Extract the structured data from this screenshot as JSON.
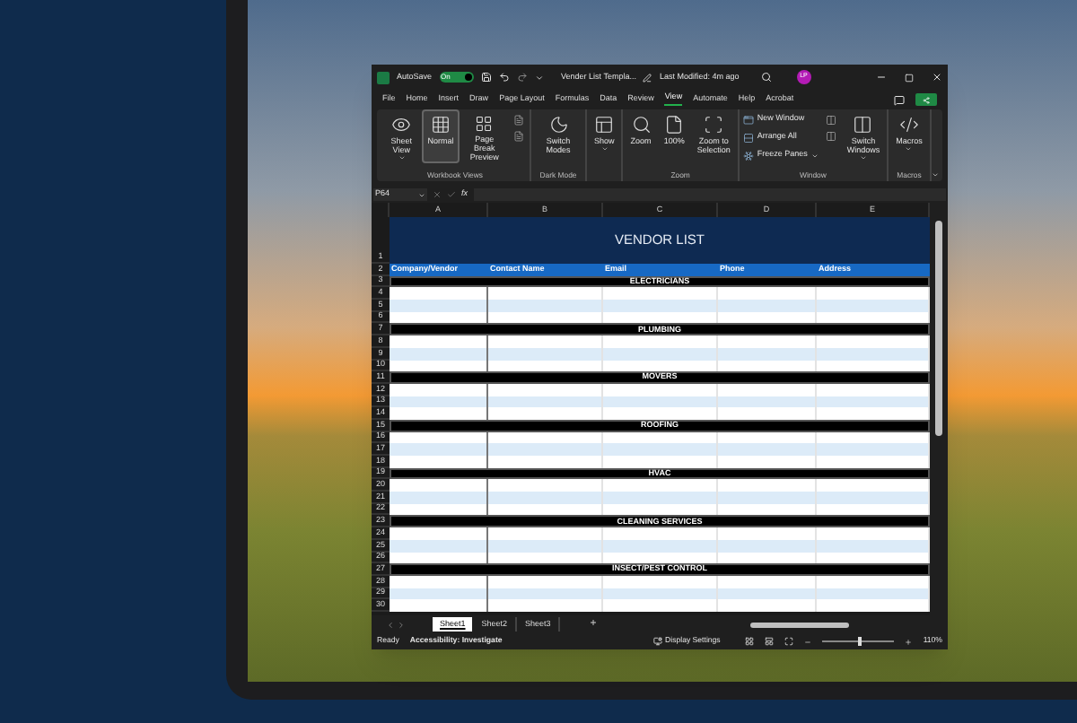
{
  "window": {
    "autosave": {
      "label": "AutoSave",
      "on": true,
      "state_text": "On"
    },
    "title": "Vender List Templa...",
    "modified": "Last Modified: 4m ago",
    "avatar": "LP"
  },
  "menu": [
    {
      "label": "File",
      "selected": false
    },
    {
      "label": "Home",
      "selected": false
    },
    {
      "label": "Insert",
      "selected": false
    },
    {
      "label": "Draw",
      "selected": false
    },
    {
      "label": "Page Layout",
      "selected": false
    },
    {
      "label": "Formulas",
      "selected": false
    },
    {
      "label": "Data",
      "selected": false
    },
    {
      "label": "Review",
      "selected": false
    },
    {
      "label": "View",
      "selected": true
    },
    {
      "label": "Automate",
      "selected": false
    },
    {
      "label": "Help",
      "selected": false
    },
    {
      "label": "Acrobat",
      "selected": false
    }
  ],
  "ribbon": [
    {
      "label": "Workbook Views",
      "buttons": [
        {
          "kind": "large",
          "label": "Sheet View",
          "selected": false,
          "dropdown": true
        },
        {
          "kind": "large",
          "label": "Normal",
          "selected": true,
          "dropdown": false
        },
        {
          "kind": "large",
          "label": "Page Break Preview",
          "selected": false,
          "dropdown": false
        }
      ]
    },
    {
      "label": "Dark Mode",
      "buttons": [
        {
          "kind": "large",
          "label": "Switch Modes",
          "selected": false,
          "dropdown": false
        }
      ]
    },
    {
      "buttons": [
        {
          "kind": "large",
          "label": "Show",
          "selected": false,
          "dropdown": true
        }
      ]
    },
    {
      "label": "Zoom",
      "buttons": [
        {
          "kind": "large",
          "label": "Zoom",
          "selected": false,
          "dropdown": false
        },
        {
          "kind": "large",
          "label": "100%",
          "selected": false,
          "dropdown": false
        },
        {
          "kind": "large",
          "label": "Zoom to Selection",
          "selected": false,
          "dropdown": false
        }
      ]
    },
    {
      "label": "Window",
      "buttons": [
        {
          "kind": "small",
          "label": "New Window",
          "selected": false,
          "dropdown": false
        },
        {
          "kind": "small",
          "label": "Arrange All",
          "selected": false,
          "dropdown": false
        },
        {
          "kind": "small",
          "label": "Freeze Panes",
          "selected": false,
          "dropdown": true
        },
        {
          "kind": "large",
          "label": "Switch Windows",
          "selected": false,
          "dropdown": true
        }
      ]
    },
    {
      "label": "Macros",
      "buttons": [
        {
          "kind": "large",
          "label": "Macros",
          "selected": false,
          "dropdown": true
        }
      ]
    }
  ],
  "formula_bar": {
    "name_box": "P64",
    "fx": "fx"
  },
  "columns": [
    "A",
    "B",
    "C",
    "D",
    "E"
  ],
  "rows": [
    {
      "number": "1",
      "kind": "title",
      "text": "VENDOR LIST"
    },
    {
      "number": "2",
      "kind": "header",
      "cells": [
        "Company/Vendor",
        "Contact Name",
        "Email",
        "Phone",
        "Address"
      ]
    },
    {
      "number": "3",
      "kind": "section",
      "text": "ELECTRICIANS"
    },
    {
      "number": "4",
      "kind": "blank",
      "shaded": false
    },
    {
      "number": "5",
      "kind": "blank",
      "shaded": true
    },
    {
      "number": "6",
      "kind": "blank",
      "shaded": false
    },
    {
      "number": "7",
      "kind": "section",
      "text": "PLUMBING"
    },
    {
      "number": "8",
      "kind": "blank",
      "shaded": false
    },
    {
      "number": "9",
      "kind": "blank",
      "shaded": true
    },
    {
      "number": "10",
      "kind": "blank",
      "shaded": false
    },
    {
      "number": "11",
      "kind": "section",
      "text": "MOVERS"
    },
    {
      "number": "12",
      "kind": "blank",
      "shaded": false
    },
    {
      "number": "13",
      "kind": "blank",
      "shaded": true
    },
    {
      "number": "14",
      "kind": "blank",
      "shaded": false
    },
    {
      "number": "15",
      "kind": "section",
      "text": "ROOFING"
    },
    {
      "number": "16",
      "kind": "blank",
      "shaded": false
    },
    {
      "number": "17",
      "kind": "blank",
      "shaded": true
    },
    {
      "number": "18",
      "kind": "blank",
      "shaded": false
    },
    {
      "number": "19",
      "kind": "section",
      "text": "HVAC"
    },
    {
      "number": "20",
      "kind": "blank",
      "shaded": false
    },
    {
      "number": "21",
      "kind": "blank",
      "shaded": true
    },
    {
      "number": "22",
      "kind": "blank",
      "shaded": false
    },
    {
      "number": "23",
      "kind": "section",
      "text": "CLEANING SERVICES"
    },
    {
      "number": "24",
      "kind": "blank",
      "shaded": false
    },
    {
      "number": "25",
      "kind": "blank",
      "shaded": true
    },
    {
      "number": "26",
      "kind": "blank",
      "shaded": false
    },
    {
      "number": "27",
      "kind": "section",
      "text": "INSECT/PEST CONTROL"
    },
    {
      "number": "28",
      "kind": "blank",
      "shaded": false
    },
    {
      "number": "29",
      "kind": "blank",
      "shaded": true
    },
    {
      "number": "30",
      "kind": "blank",
      "shaded": false
    }
  ],
  "sheet_tabs": [
    {
      "label": "Sheet1",
      "selected": true
    },
    {
      "label": "Sheet2",
      "selected": false
    },
    {
      "label": "Sheet3",
      "selected": false
    }
  ],
  "add_sheet": "+",
  "status_bar": {
    "ready": "Ready",
    "accessibility": "Accessibility: Investigate",
    "display_settings": "Display Settings",
    "zoom": {
      "level": 0.5,
      "reading": "110%"
    }
  }
}
